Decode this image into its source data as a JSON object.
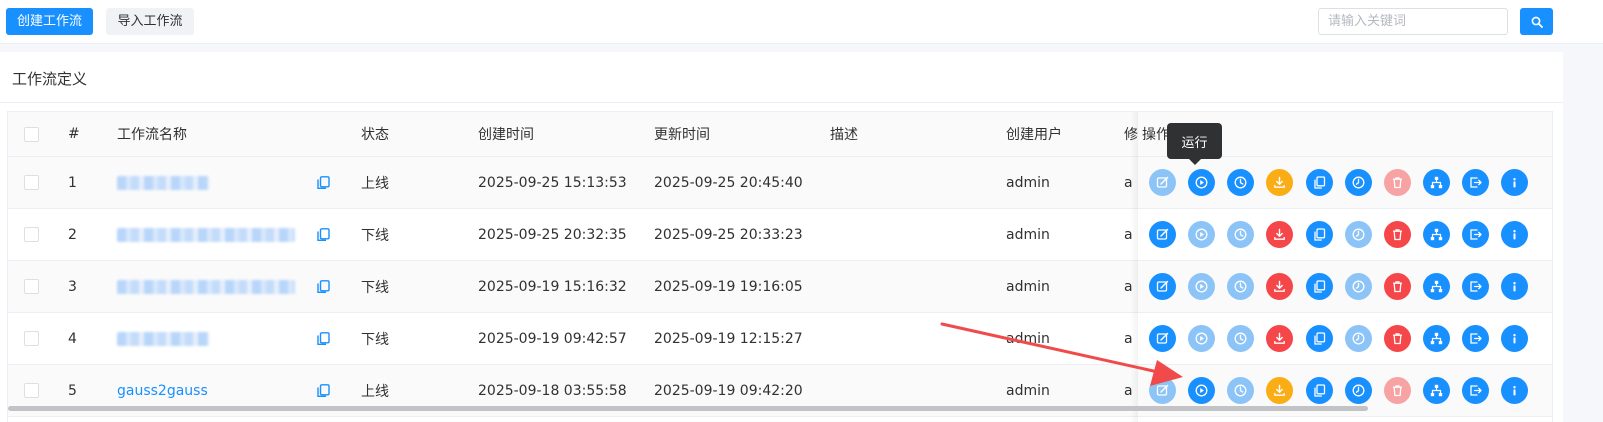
{
  "toolbar": {
    "create_label": "创建工作流",
    "import_label": "导入工作流",
    "search_placeholder": "请输入关键词"
  },
  "card": {
    "title": "工作流定义"
  },
  "table": {
    "headers": {
      "index": "#",
      "name": "工作流名称",
      "status": "状态",
      "created": "创建时间",
      "updated": "更新时间",
      "desc": "描述",
      "creator": "创建用户",
      "updater_partial": "修",
      "actions_partial": "操作"
    },
    "rows": [
      {
        "index": "1",
        "name": "",
        "status": "上线",
        "created": "2025-09-25 15:13:53",
        "updated": "2025-09-25 20:45:40",
        "creator": "admin",
        "updater_partial": "a"
      },
      {
        "index": "2",
        "name": "",
        "status": "下线",
        "created": "2025-09-25 20:32:35",
        "updated": "2025-09-25 20:33:23",
        "creator": "admin",
        "updater_partial": "a"
      },
      {
        "index": "3",
        "name": "",
        "status": "下线",
        "created": "2025-09-19 15:16:32",
        "updated": "2025-09-19 19:16:05",
        "creator": "admin",
        "updater_partial": "a"
      },
      {
        "index": "4",
        "name": "",
        "status": "下线",
        "created": "2025-09-19 09:42:57",
        "updated": "2025-09-19 12:15:27",
        "creator": "admin",
        "updater_partial": "a"
      },
      {
        "index": "5",
        "name": "gauss2gauss",
        "status": "上线",
        "created": "2025-09-18 03:55:58",
        "updated": "2025-09-19 09:42:20",
        "creator": "admin",
        "updater_partial": "a"
      }
    ],
    "action_icons": [
      "edit-icon",
      "run-icon",
      "timing-icon",
      "export-icon",
      "copy-icon",
      "schedule-icon",
      "delete-icon",
      "tree-icon",
      "offline-icon",
      "info-icon"
    ],
    "action_states": [
      [
        "blue-l",
        "blue",
        "blue",
        "orange",
        "blue",
        "blue",
        "red-l",
        "blue",
        "blue",
        "blue"
      ],
      [
        "blue",
        "blue-l",
        "blue-l",
        "red",
        "blue",
        "blue-l",
        "red",
        "blue",
        "blue",
        "blue"
      ],
      [
        "blue",
        "blue-l",
        "blue-l",
        "red",
        "blue",
        "blue-l",
        "red",
        "blue",
        "blue",
        "blue"
      ],
      [
        "blue",
        "blue-l",
        "blue-l",
        "red",
        "blue",
        "blue-l",
        "red",
        "blue",
        "blue",
        "blue"
      ],
      [
        "blue-l",
        "blue",
        "blue-l",
        "orange",
        "blue",
        "blue",
        "red-l",
        "blue",
        "blue",
        "blue"
      ]
    ]
  },
  "tooltip": {
    "text": "运行"
  },
  "colors": {
    "primary": "#1890ff",
    "primary_light": "#8cc4f8",
    "orange": "#faad14",
    "red": "#f5464a",
    "red_light": "#f7a3a4",
    "annotation_arrow": "#f04a4a"
  }
}
